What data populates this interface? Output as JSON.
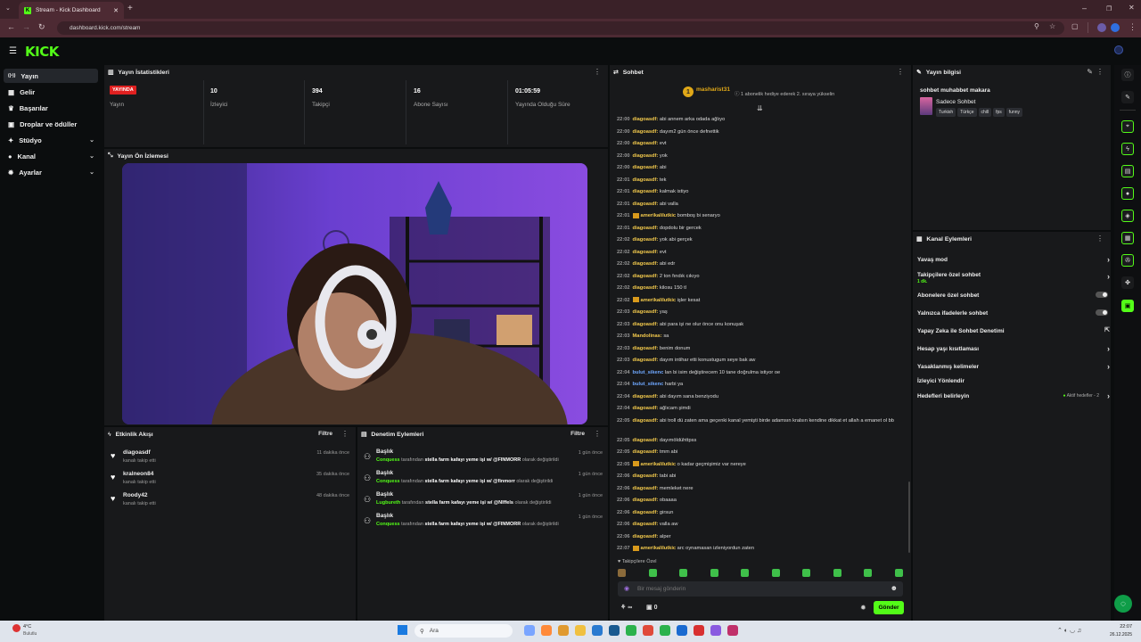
{
  "browser": {
    "tab_title": "Stream - Kick Dashboard",
    "url": "dashboard.kick.com/stream",
    "fav": "K"
  },
  "logo": "KICK",
  "sidebar": {
    "items": [
      {
        "label": "Yayın",
        "icon": "radio-icon",
        "glyph": "((•))"
      },
      {
        "label": "Gelir",
        "icon": "wallet-icon",
        "glyph": "▦"
      },
      {
        "label": "Başarılar",
        "icon": "trophy-icon",
        "glyph": "♛"
      },
      {
        "label": "Droplar ve ödüller",
        "icon": "gift-icon",
        "glyph": "▣"
      },
      {
        "label": "Stüdyo",
        "icon": "studio-icon",
        "glyph": "✦"
      },
      {
        "label": "Kanal",
        "icon": "person-icon",
        "glyph": "●"
      },
      {
        "label": "Ayarlar",
        "icon": "gear-icon",
        "glyph": "✹"
      }
    ]
  },
  "stats": {
    "title": "Yayın İstatistikleri",
    "items": [
      {
        "value": "YAYINDA",
        "label": "Yayın"
      },
      {
        "value": "10",
        "label": "İzleyici"
      },
      {
        "value": "394",
        "label": "Takipçi"
      },
      {
        "value": "16",
        "label": "Abone Sayısı"
      },
      {
        "value": "01:05:59",
        "label": "Yayında Olduğu Süre"
      }
    ]
  },
  "preview": {
    "title": "Yayın Ön İzlemesi"
  },
  "activity": {
    "title": "Etkinlik Akışı",
    "filter": "Filtre",
    "items": [
      {
        "name": "diagoasdf",
        "sub": "kanalı takip etti",
        "time": "11 dakika önce"
      },
      {
        "name": "kralneon84",
        "sub": "kanalı takip etti",
        "time": "35 dakika önce"
      },
      {
        "name": "Roody42",
        "sub": "kanalı takip etti",
        "time": "48 dakika önce"
      }
    ]
  },
  "moderation": {
    "title": "Denetim Eylemleri",
    "filter": "Filtre",
    "items": [
      {
        "name": "Başlık",
        "who": "Conquess",
        "mid": "tarafından",
        "what": "stella farm kafayı yeme işi w/ @FINMORR",
        "end": "olarak değiştirildi",
        "time": "1 gün önce"
      },
      {
        "name": "Başlık",
        "who": "Conquess",
        "mid": "tarafından",
        "what": "stella farm kafayı yeme işi w/ @finmorr",
        "end": "olarak değiştirildi",
        "time": "1 gün önce"
      },
      {
        "name": "Başlık",
        "who": "Lugbureth",
        "mid": "tarafından",
        "what": "stella farm kafayı yeme işi w/ @Nlffels",
        "end": "olarak değiştirildi",
        "time": "1 gün önce"
      },
      {
        "name": "Başlık",
        "who": "Conquess",
        "mid": "tarafından",
        "what": "stella farm kafayı yeme işi w/ @FINMORR",
        "end": "olarak değiştirildi",
        "time": "1 gün önce"
      }
    ]
  },
  "chat": {
    "title": "Sohbet",
    "pinned_user": "masharist31",
    "pinned_rank": "1",
    "pinned_text": "1 abonelik hediye ederek 2. sıraya yükselin",
    "messages": [
      {
        "t": "22:00",
        "u": "diagoasdf:",
        "m": "abi annem arka odada ağlıyo"
      },
      {
        "t": "22:00",
        "u": "diagoasdf:",
        "m": "dayım2 gün önce defnettik"
      },
      {
        "t": "22:00",
        "u": "diagoasdf:",
        "m": "evt"
      },
      {
        "t": "22:00",
        "u": "diagoasdf:",
        "m": "yok"
      },
      {
        "t": "22:00",
        "u": "diagoasdf:",
        "m": "abi"
      },
      {
        "t": "22:01",
        "u": "diagoasdf:",
        "m": "tek"
      },
      {
        "t": "22:01",
        "u": "diagoasdf:",
        "m": "kalmak istiyo"
      },
      {
        "t": "22:01",
        "u": "diagoasdf:",
        "m": "abi valla"
      },
      {
        "t": "22:01",
        "u": "amerikalilutkic",
        "m": "bomboş bi senaryo",
        "badge": true
      },
      {
        "t": "22:01",
        "u": "diagoasdf:",
        "m": "dopdolu bir gercek"
      },
      {
        "t": "22:02",
        "u": "diagoasdf:",
        "m": "yok abi gerçek"
      },
      {
        "t": "22:02",
        "u": "diagoasdf:",
        "m": "evt"
      },
      {
        "t": "22:02",
        "u": "diagoasdf:",
        "m": "abi edr"
      },
      {
        "t": "22:02",
        "u": "diagoasdf:",
        "m": "2 ton fındık cıkıyo"
      },
      {
        "t": "22:02",
        "u": "diagoasdf:",
        "m": "kilosu 150 tl"
      },
      {
        "t": "22:02",
        "u": "amerikalilutkic",
        "m": "işler kesat",
        "badge": true
      },
      {
        "t": "22:03",
        "u": "diagoasdf:",
        "m": "yaş"
      },
      {
        "t": "22:03",
        "u": "diagoasdf:",
        "m": "abi para işi ne olur önce onu konuşak"
      },
      {
        "t": "22:03",
        "u": "Mandolinas:",
        "m": "sa"
      },
      {
        "t": "22:03",
        "u": "diagoasdf:",
        "m": "benim donum"
      },
      {
        "t": "22:03",
        "u": "diagoasdf:",
        "m": "dayım intihar etti konustugum seye bak aw"
      },
      {
        "t": "22:04",
        "u": "bulut_sikenc",
        "m": "lan bi isim değiştirecem 10 tane doğrulma istiyor oe",
        "blue": true
      },
      {
        "t": "22:04",
        "u": "bulut_sikenc",
        "m": "harbi ya",
        "blue": true
      },
      {
        "t": "22:04",
        "u": "diagoasdf:",
        "m": "abi dayım sana benziyodu"
      },
      {
        "t": "22:04",
        "u": "diagoasdf:",
        "m": "ağlıcam şimdi"
      },
      {
        "t": "22:05",
        "u": "diagoasdf:",
        "m": "abi troll dü zaten ama geçenki kanal yemişti birde adamsın kralsın kendine dikkat et allah a emanet ol bb",
        "wrap": true
      },
      {
        "t": "22:05",
        "u": "diagoasdf:",
        "m": "dayımöldühttpss"
      },
      {
        "t": "22:05",
        "u": "diagoasdf:",
        "m": "tmm abi"
      },
      {
        "t": "22:05",
        "u": "amerikalilutkic",
        "m": "o kadar geçmişimiz var nereye",
        "badge": true
      },
      {
        "t": "22:06",
        "u": "diagoasdf:",
        "m": "tabi abi"
      },
      {
        "t": "22:06",
        "u": "diagoasdf:",
        "m": "memleket nere"
      },
      {
        "t": "22:06",
        "u": "diagoasdf:",
        "m": "obaaaa"
      },
      {
        "t": "22:06",
        "u": "diagoasdf:",
        "m": "girsun"
      },
      {
        "t": "22:06",
        "u": "diagoasdf:",
        "m": "valla aw"
      },
      {
        "t": "22:06",
        "u": "diagoasdf:",
        "m": "alper"
      },
      {
        "t": "22:07",
        "u": "amerikalilutkic",
        "m": "arc oynamasan izleniyordun zaten",
        "badge": true
      }
    ],
    "followers_only": "Takipçilere Özel",
    "placeholder": "Bir mesaj gönderin",
    "send": "Gönder",
    "points_infinity": "∞",
    "gift_count": "0"
  },
  "channel_info": {
    "title": "Yayın bilgisi",
    "stream_title": "sohbet muhabbet makara",
    "category": "Sadece Sohbet",
    "tags": [
      "Turkish",
      "Türkçe",
      "chill",
      "fps",
      "funny"
    ]
  },
  "channel_actions": {
    "title": "Kanal Eylemleri",
    "items": [
      {
        "label": "Yavaş mod",
        "kind": "arrow"
      },
      {
        "label": "Takipçilere özel sohbet",
        "sub": "1 dk.",
        "kind": "arrow"
      },
      {
        "label": "Abonelere özel sohbet",
        "kind": "toggle"
      },
      {
        "label": "Yalnızca ifadelerle sohbet",
        "kind": "toggle"
      },
      {
        "label": "Yapay Zeka ile Sohbet Denetimi",
        "kind": "external"
      },
      {
        "label": "Hesap yaşı kısıtlaması",
        "kind": "arrow"
      },
      {
        "label": "Yasaklanmış kelimeler",
        "kind": "arrow"
      },
      {
        "label": "İzleyici Yönlendir",
        "kind": "none"
      },
      {
        "label": "Hedefleri belirleyin",
        "sub": "Aktif hedefler - 2",
        "kind": "arrow"
      }
    ]
  },
  "taskbar": {
    "weather_temp": "4°C",
    "weather_desc": "Bulutlu",
    "search": "Ara",
    "time": "22:07",
    "date": "26.12.2025"
  }
}
